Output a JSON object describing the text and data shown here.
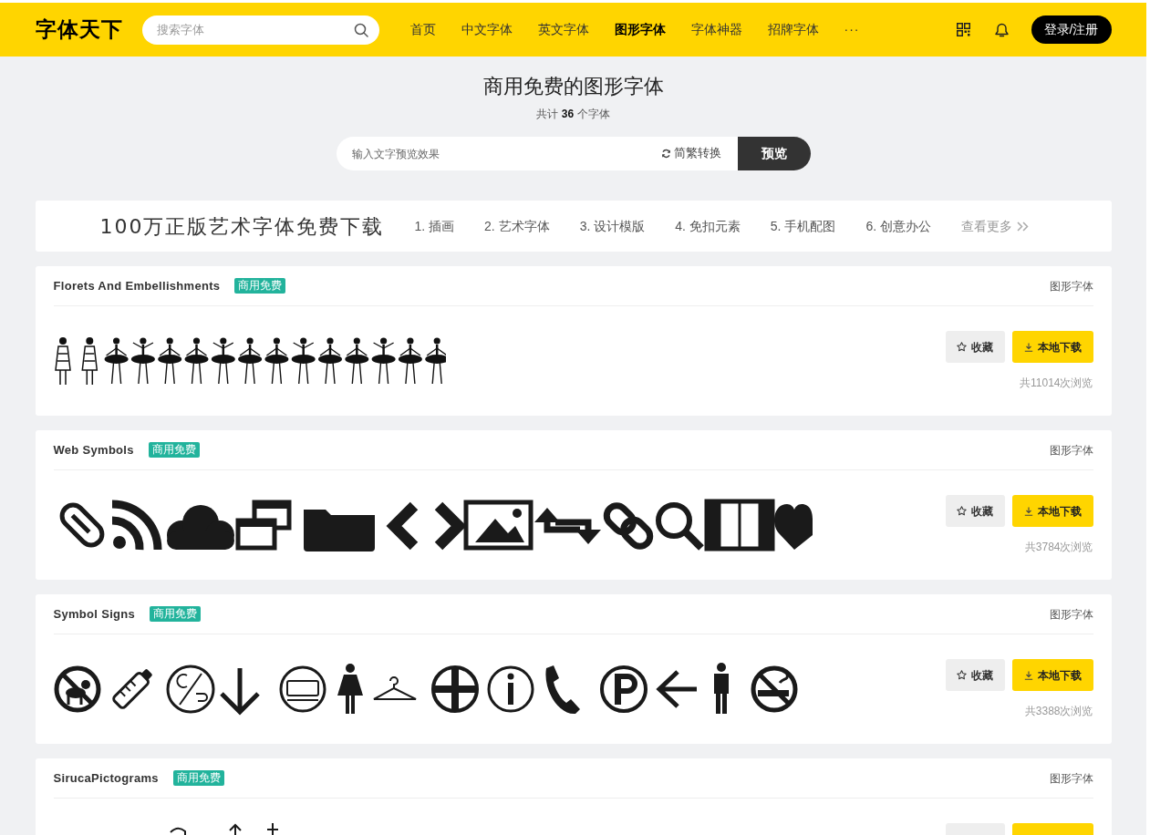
{
  "header": {
    "logo": "字体天下",
    "search": {
      "placeholder": "搜索字体"
    },
    "nav": [
      {
        "label": "首页",
        "selected": false
      },
      {
        "label": "中文字体",
        "selected": false
      },
      {
        "label": "英文字体",
        "selected": false
      },
      {
        "label": "图形字体",
        "selected": true
      },
      {
        "label": "字体神器",
        "selected": false
      },
      {
        "label": "招牌字体",
        "selected": false
      }
    ],
    "more": "···",
    "login_button": "登录/注册"
  },
  "page_title": "商用免费的图形字体",
  "count": "共计 **36** 个字体",
  "preview_bar": {
    "placeholder": "输入文字预览效果",
    "convert": "简繁转换",
    "button": "预览"
  },
  "banner": {
    "slogan": "100万正版艺术字体免费下载",
    "links": [
      "1. 插画",
      "2. 艺术字体",
      "3. 设计模版",
      "4. 免扣元素",
      "5. 手机配图",
      "6. 创意办公"
    ],
    "more": "查看更多"
  },
  "fonts": [
    {
      "name": "Florets And Embellishments",
      "badge": "商用免费",
      "category": "图形字体",
      "kind": "figures",
      "favorite_button": "收藏",
      "download_button": "本地下载",
      "views": "共11014次浏览"
    },
    {
      "name": "Web Symbols",
      "badge": "商用免费",
      "category": "图形字体",
      "kind": "symbols",
      "favorite_button": "收藏",
      "download_button": "本地下载",
      "views": "共3784次浏览"
    },
    {
      "name": "Symbol Signs",
      "badge": "商用免费",
      "category": "图形字体",
      "kind": "signs",
      "favorite_button": "收藏",
      "download_button": "本地下载",
      "views": "共3388次浏览"
    },
    {
      "name": "SirucaPictograms",
      "badge": "商用免费",
      "category": "图形字体",
      "kind": "pictograms"
    }
  ]
}
